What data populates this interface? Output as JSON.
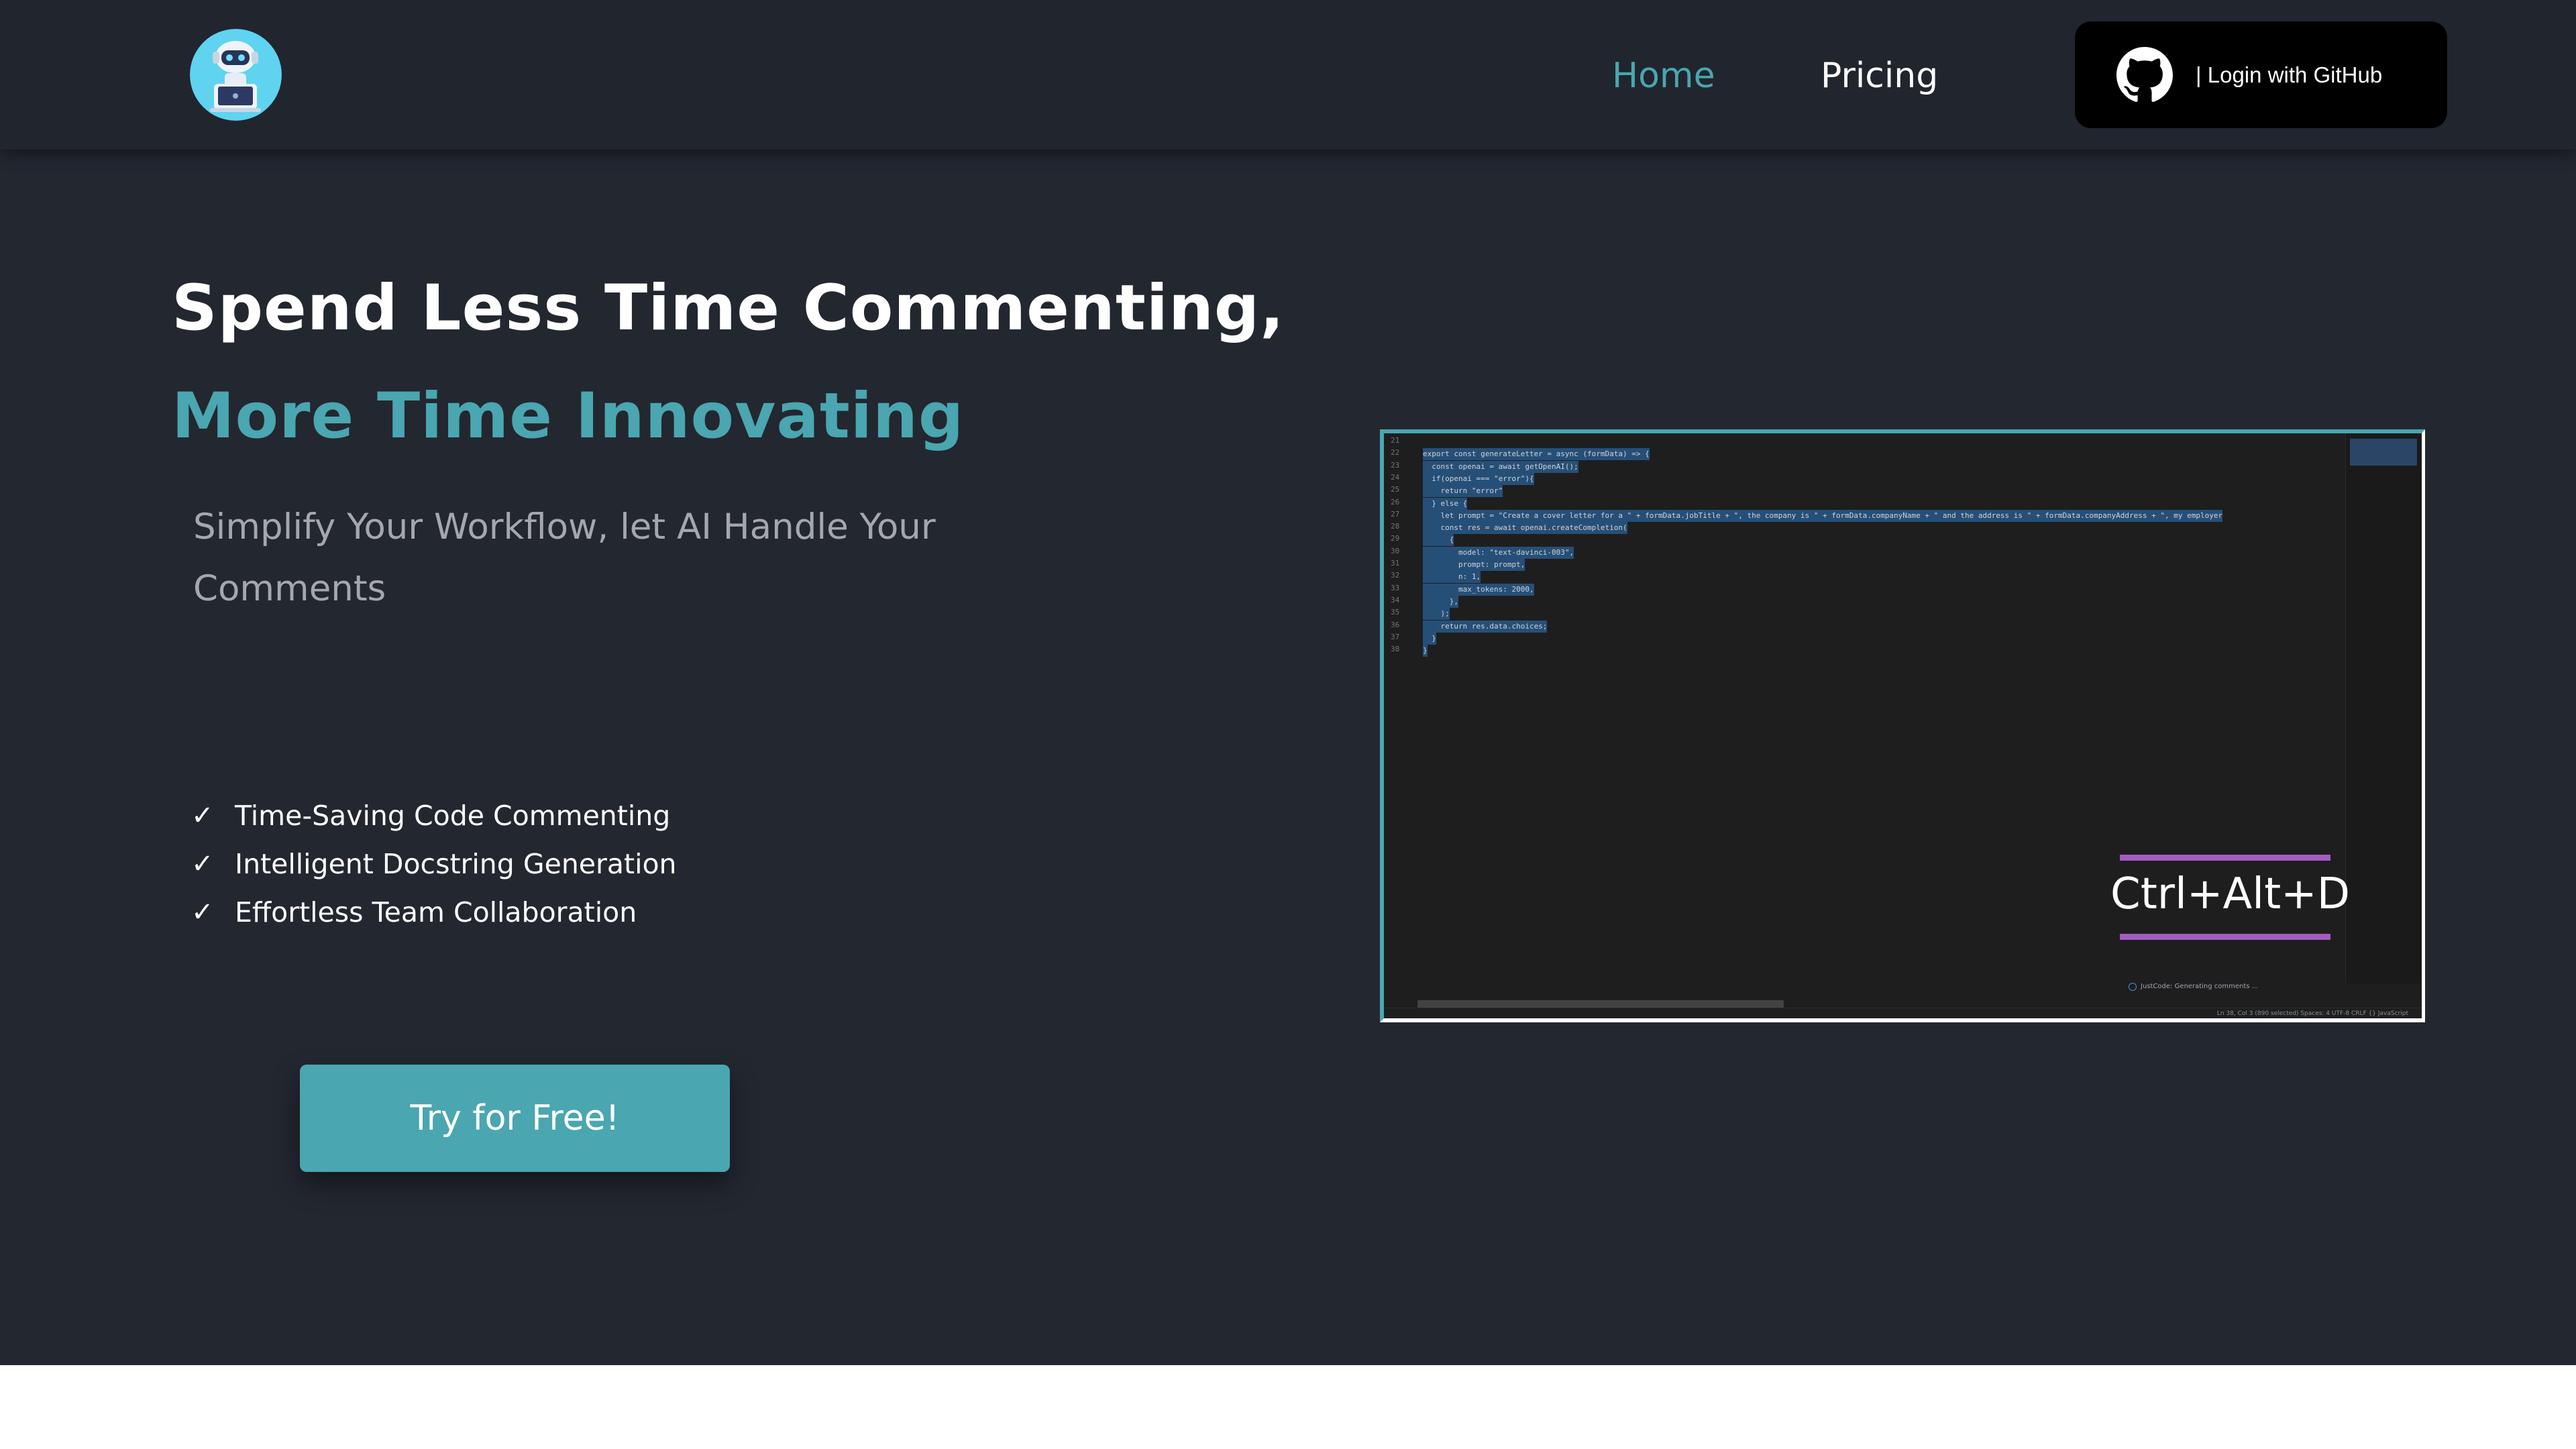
{
  "colors": {
    "background": "#232730",
    "navbar": "#21252e",
    "accent": "#4aa6b0",
    "login_button": "#000000",
    "shortcut_highlight": "#a45cc0",
    "bottom_section": "#ffffff"
  },
  "navbar": {
    "logo_icon": "robot-mascot-icon",
    "links": [
      {
        "label": "Home"
      },
      {
        "label": "Pricing"
      }
    ],
    "login": {
      "icon": "github-icon",
      "label": "| Login with GitHub"
    }
  },
  "hero": {
    "headline_line1": "Spend Less Time Commenting,",
    "headline_line2": "More Time Innovating",
    "subtitle": "Simplify Your Workflow, let AI Handle Your Comments",
    "features": [
      {
        "check": "✓",
        "label": "Time-Saving Code Commenting"
      },
      {
        "check": "✓",
        "label": "Intelligent Docstring Generation"
      },
      {
        "check": "✓",
        "label": "Effortless Team Collaboration"
      }
    ],
    "cta_label": "Try for Free!"
  },
  "demo": {
    "line_numbers": [
      "21",
      "22",
      "23",
      "24",
      "25",
      "26",
      "27",
      "28",
      "29",
      "30",
      "31",
      "32",
      "33",
      "34",
      "35",
      "36",
      "37",
      "38"
    ],
    "code_lines": [
      "",
      "export const generateLetter = async (formData) => {",
      "  const openai = await getOpenAI();",
      "  if(openai === \"error\"){",
      "    return \"error\"",
      "  } else {",
      "    let prompt = \"Create a cover letter for a \" + formData.jobTitle + \", the company is \" + formData.companyName + \" and the address is \" + formData.companyAddress + \", my employer",
      "    const res = await openai.createCompletion(",
      "      {",
      "        model: \"text-davinci-003\",",
      "        prompt: prompt,",
      "        n: 1,",
      "        max_tokens: 2000,",
      "      },",
      "    );",
      "    return res.data.choices;",
      "  }",
      "}"
    ],
    "notification": "JustCode: Generating comments ...",
    "status_bar": "Ln 38, Col 3 (890 selected)   Spaces: 4   UTF-8   CRLF   {} JavaScript",
    "shortcut": "Ctrl+Alt+D"
  }
}
